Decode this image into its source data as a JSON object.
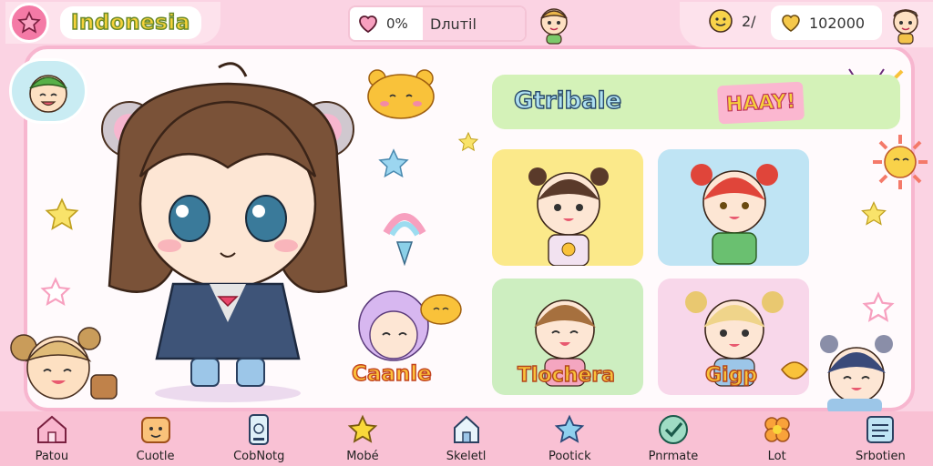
{
  "header": {
    "country": "Indonesia",
    "center_percent": "0%",
    "center_name": "Dлuтil",
    "stat_a": "2/",
    "stat_b": "102000"
  },
  "main": {
    "left_caption": "Caanle",
    "banner_title": "Gtribale",
    "banner_tag": "HAAY!",
    "cards": [
      {
        "label": "",
        "color": "#fbe98a"
      },
      {
        "label": "",
        "color": "#bfe4f4"
      },
      {
        "label": "Tlochera",
        "color": "#cdeec0"
      },
      {
        "label": "Gigp",
        "color": "#f8d7ea"
      }
    ]
  },
  "nav": {
    "items": [
      {
        "label": "Patou",
        "icon": "house-icon"
      },
      {
        "label": "Cuotle",
        "icon": "bear-face-icon"
      },
      {
        "label": "CobNotg",
        "icon": "phone-icon"
      },
      {
        "label": "Mobé",
        "icon": "star-icon"
      },
      {
        "label": "Skeletl",
        "icon": "home-icon"
      },
      {
        "label": "Pootick",
        "icon": "sparkle-star-icon"
      },
      {
        "label": "Pnrmate",
        "icon": "check-icon"
      },
      {
        "label": "Lot",
        "icon": "flower-icon"
      },
      {
        "label": "Srbotien",
        "icon": "book-icon"
      }
    ]
  },
  "colors": {
    "background": "#fbd3e3",
    "accent_pink": "#f47aa6",
    "banner_green": "#d4f2b8"
  }
}
